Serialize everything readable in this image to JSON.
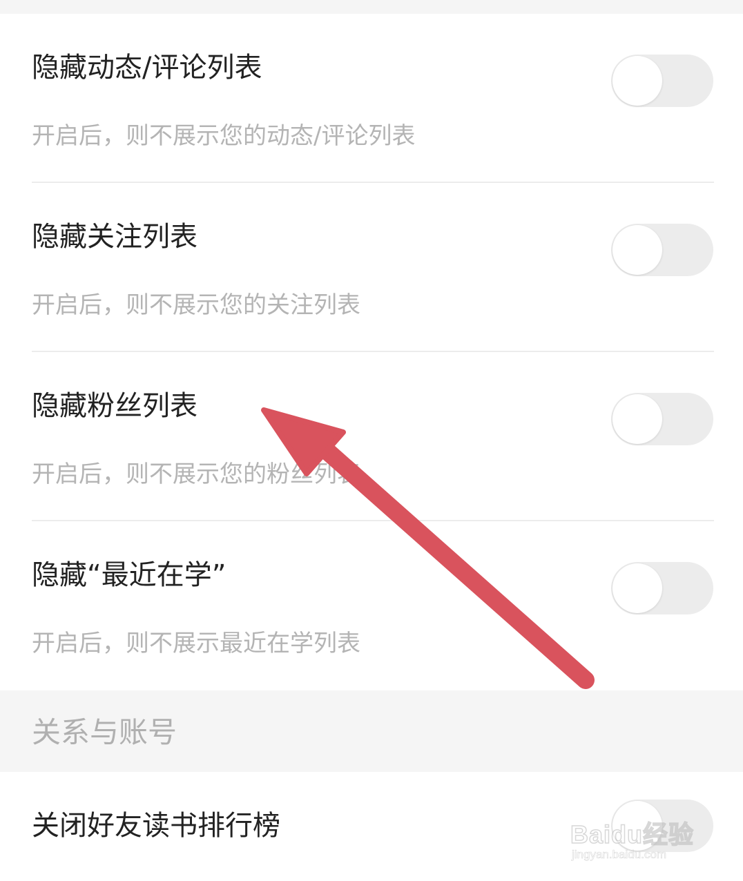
{
  "privacy_settings": [
    {
      "title": "隐藏动态/评论列表",
      "description": "开启后，则不展示您的动态/评论列表",
      "enabled": false
    },
    {
      "title": "隐藏关注列表",
      "description": "开启后，则不展示您的关注列表",
      "enabled": false
    },
    {
      "title": "隐藏粉丝列表",
      "description": "开启后，则不展示您的粉丝列表",
      "enabled": false
    },
    {
      "title": "隐藏“最近在学”",
      "description": "开启后，则不展示最近在学列表",
      "enabled": false
    }
  ],
  "relationship_section": {
    "header": "关系与账号",
    "items": [
      {
        "title": "关闭好友读书排行榜",
        "enabled": false
      }
    ]
  },
  "annotation": {
    "arrow_color": "#d9535d"
  },
  "watermark": {
    "logo_text": "Baidu经验",
    "url_text": "jingyan.baidu.com"
  },
  "colors": {
    "toggle_off": "#ececec",
    "section_bg": "#f5f5f5",
    "title_text": "#222222",
    "desc_text": "#b4b4b4"
  }
}
